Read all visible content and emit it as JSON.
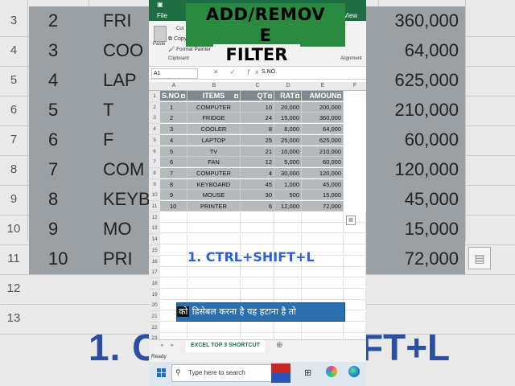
{
  "overlay": {
    "title_line1": "ADD/REMOV",
    "title_line2": "E",
    "title_line3": "FILTER",
    "shortcut": "1. CTRL+SHIFT+L",
    "caption_first": "को",
    "caption_rest": " डिसेबल करना है यह हटाना है तो",
    "bg_big_left": "1. C",
    "bg_big_right": "FT+L"
  },
  "ribbon": {
    "file": "File",
    "view": "View",
    "copy": "Copy",
    "format_painter": "Format Painter",
    "paste": "Paste",
    "clipboard_group": "Clipboard",
    "alignment_group": "Alignment",
    "cut": "Cut"
  },
  "formula_bar": {
    "name_box": "A1",
    "value": "S.NO."
  },
  "columns": [
    "A",
    "B",
    "C",
    "D",
    "E",
    "F"
  ],
  "table": {
    "headers": [
      "S.NO.",
      "ITEMS",
      "QTY",
      "RATE",
      "AMOUNT"
    ],
    "rows": [
      [
        "1",
        "COMPUTER",
        "10",
        "20,000",
        "200,000"
      ],
      [
        "2",
        "FRIDGE",
        "24",
        "15,000",
        "360,000"
      ],
      [
        "3",
        "COOLER",
        "8",
        "8,000",
        "64,000"
      ],
      [
        "4",
        "LAPTOP",
        "25",
        "25,000",
        "625,000"
      ],
      [
        "5",
        "TV",
        "21",
        "10,000",
        "210,000"
      ],
      [
        "6",
        "FAN",
        "12",
        "5,000",
        "60,000"
      ],
      [
        "7",
        "COMPUTER",
        "4",
        "30,000",
        "120,000"
      ],
      [
        "8",
        "KEYBOARD",
        "45",
        "1,000",
        "45,000"
      ],
      [
        "9",
        "MOUSE",
        "30",
        "500",
        "15,000"
      ],
      [
        "10",
        "PRINTER",
        "6",
        "12,000",
        "72,000"
      ]
    ]
  },
  "row_numbers": [
    "1",
    "2",
    "3",
    "4",
    "5",
    "6",
    "7",
    "8",
    "9",
    "10",
    "11",
    "12",
    "13",
    "14",
    "15",
    "16",
    "17",
    "18",
    "19",
    "20",
    "21",
    "22",
    "23",
    "24",
    "25"
  ],
  "background_rows": [
    {
      "rn": "3",
      "sn": "2",
      "item": "FRI",
      "amt": "360,000"
    },
    {
      "rn": "4",
      "sn": "3",
      "item": "COO",
      "amt": "64,000"
    },
    {
      "rn": "5",
      "sn": "4",
      "item": "LAP",
      "amt": "625,000"
    },
    {
      "rn": "6",
      "sn": "5",
      "item": "T",
      "amt": "210,000"
    },
    {
      "rn": "7",
      "sn": "6",
      "item": "F",
      "amt": "60,000"
    },
    {
      "rn": "8",
      "sn": "7",
      "item": "COM",
      "amt": "120,000"
    },
    {
      "rn": "9",
      "sn": "8",
      "item": "KEYB",
      "amt": "45,000"
    },
    {
      "rn": "10",
      "sn": "9",
      "item": "MO",
      "amt": "15,000"
    },
    {
      "rn": "11",
      "sn": "10",
      "item": "PRI",
      "amt": "72,000"
    },
    {
      "rn": "12",
      "sn": "",
      "item": "",
      "amt": ""
    },
    {
      "rn": "13",
      "sn": "",
      "item": "",
      "amt": ""
    }
  ],
  "sheet_tab": "EXCEL TOP 3 SHORTCUT",
  "status": "Ready",
  "taskbar": {
    "search_placeholder": "Type here to search"
  }
}
